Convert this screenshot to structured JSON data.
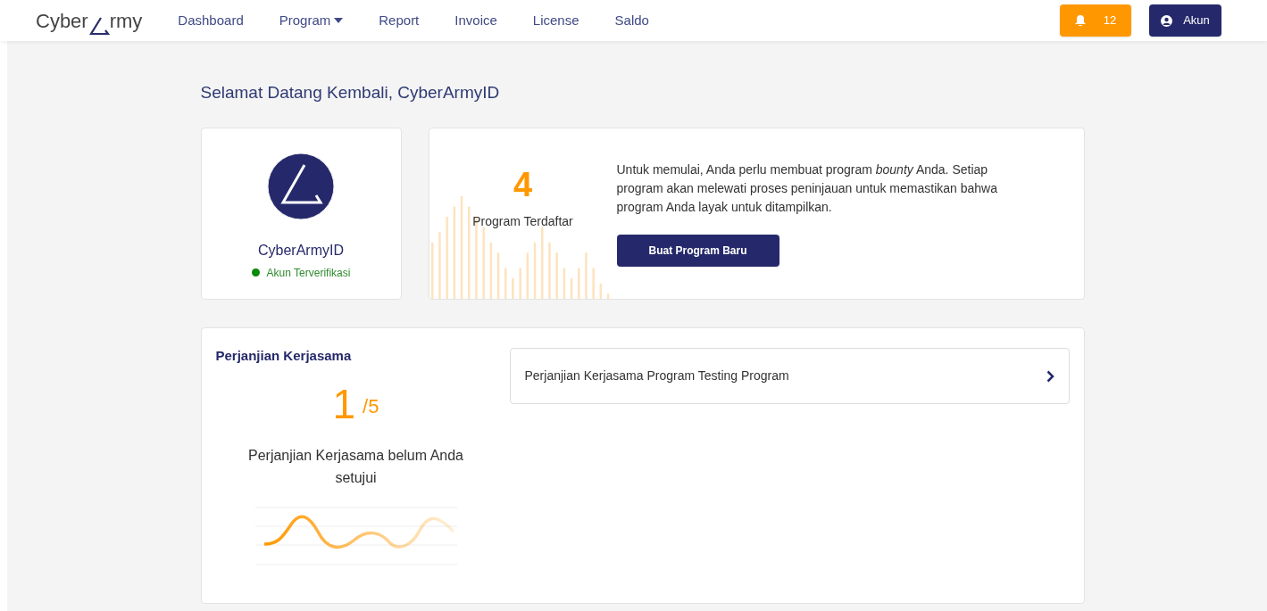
{
  "logo": {
    "before": "Cyber",
    "after": "rmy"
  },
  "nav": [
    {
      "label": "Dashboard",
      "dropdown": false
    },
    {
      "label": "Program",
      "dropdown": true
    },
    {
      "label": "Report",
      "dropdown": false
    },
    {
      "label": "Invoice",
      "dropdown": false
    },
    {
      "label": "License",
      "dropdown": false
    },
    {
      "label": "Saldo",
      "dropdown": false
    }
  ],
  "notifications": {
    "count": "12"
  },
  "account": {
    "label": "Akun"
  },
  "welcome": "Selamat Datang Kembali, CyberArmyID",
  "profile": {
    "name": "CyberArmyID",
    "verified": true,
    "status": "Akun Terverifikasi"
  },
  "programs": {
    "count": "4",
    "label": "Program Terdaftar",
    "description": "Untuk memulai, Anda perlu membuat program *bounty* Anda. Setiap program akan melewati proses peninjauan untuk memastikan bahwa program Anda layak untuk ditampilkan.",
    "button": "Buat Program Baru"
  },
  "agreements": {
    "title": "Perjanjian Kerjasama",
    "count": "1",
    "total": "/5",
    "caption": "Perjanjian Kerjasama belum Anda setujui",
    "items": [
      {
        "label": "Perjanjian Kerjasama Program Testing Program"
      }
    ]
  }
}
